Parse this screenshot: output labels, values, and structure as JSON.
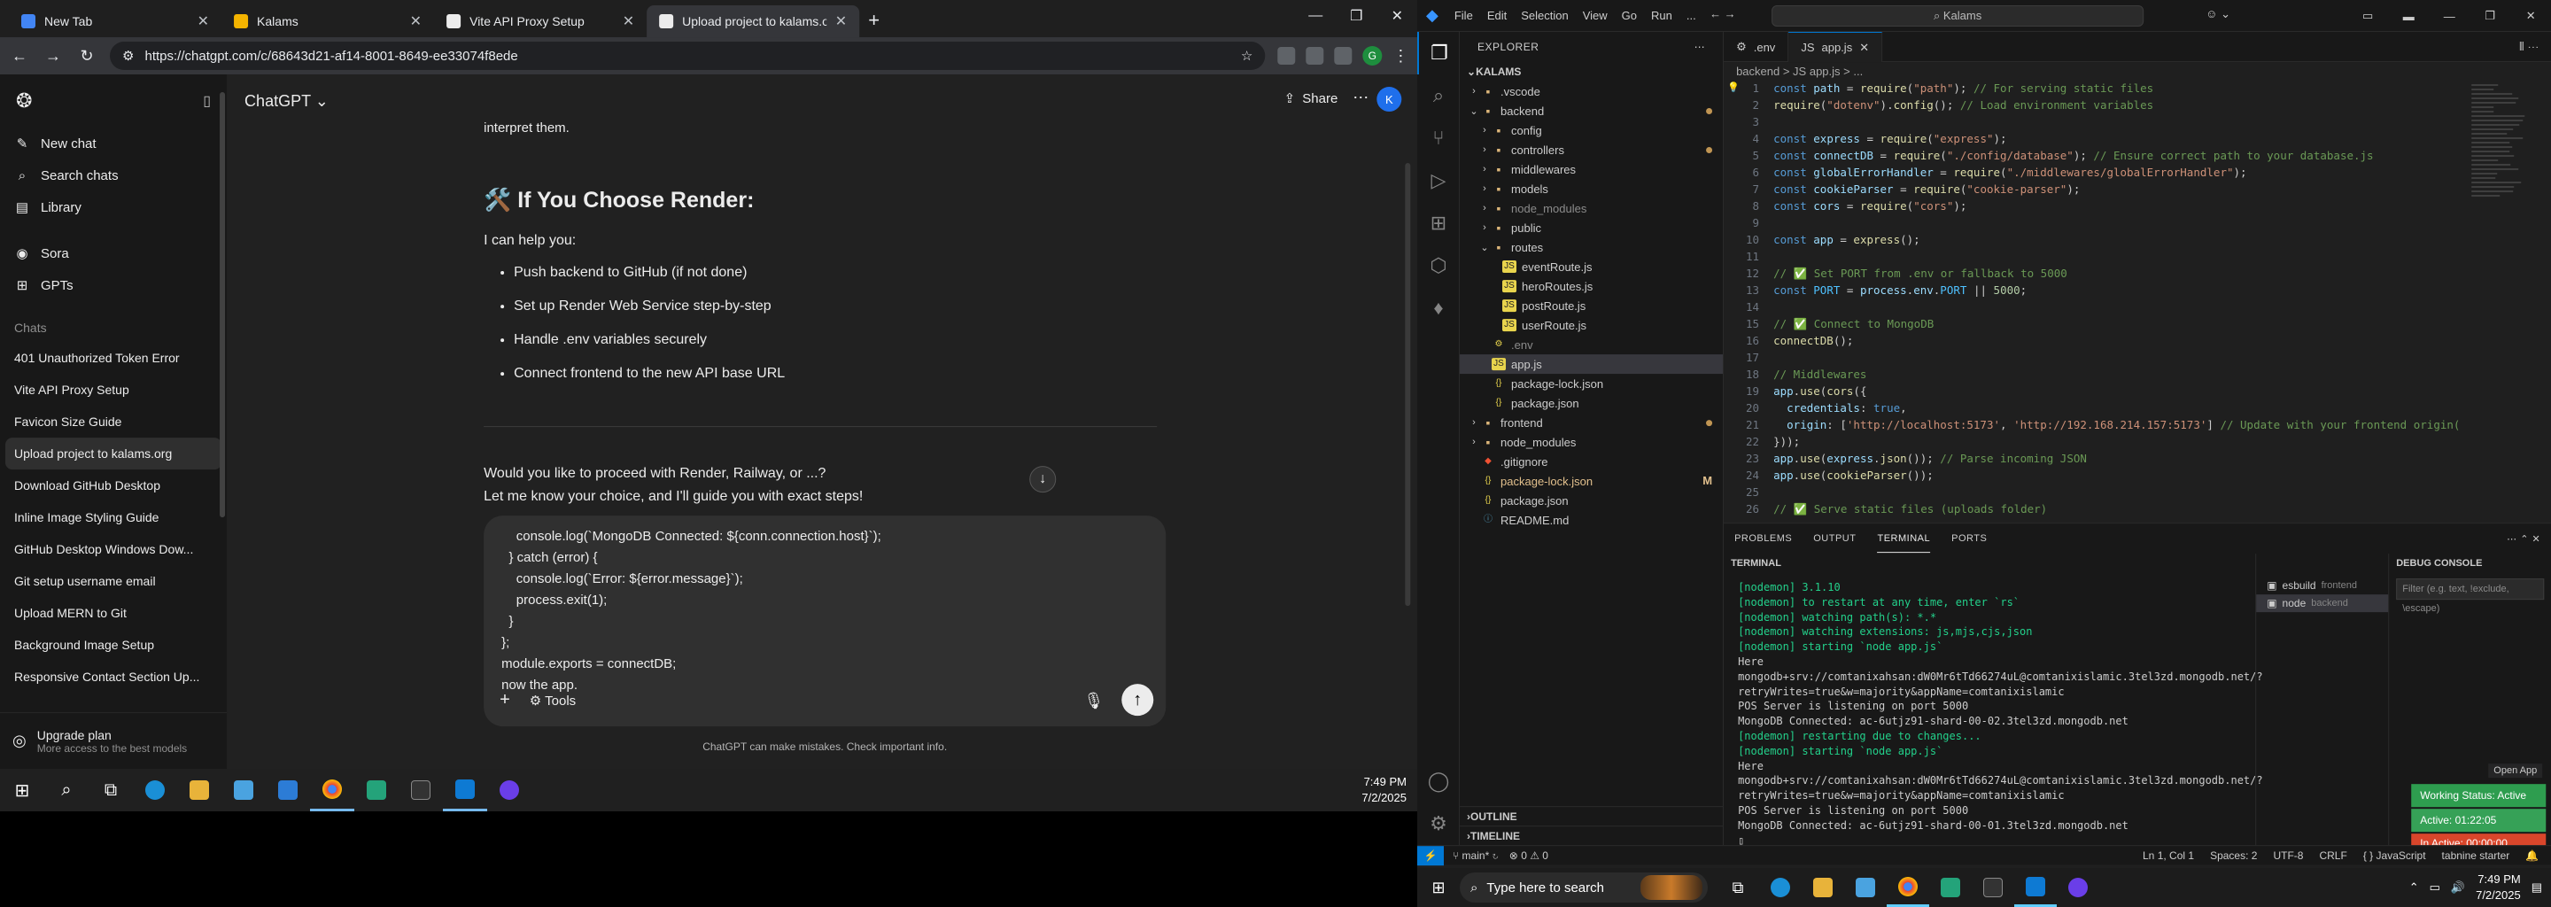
{
  "browser": {
    "tabs": [
      {
        "title": "New Tab",
        "color": "#4285f4",
        "active": false
      },
      {
        "title": "Kalams",
        "color": "#f4b400",
        "active": false
      },
      {
        "title": "Vite API Proxy Setup",
        "color": "#ececec",
        "active": false
      },
      {
        "title": "Upload project to kalams.org",
        "color": "#ececec",
        "active": true
      }
    ],
    "url": "https://chatgpt.com/c/68643d21-af14-8001-8649-ee33074f8ede"
  },
  "chatgpt": {
    "sidebar": {
      "items": [
        {
          "icon": "new-chat-icon",
          "label": "New chat"
        },
        {
          "icon": "search-icon",
          "label": "Search chats"
        },
        {
          "icon": "library-icon",
          "label": "Library"
        }
      ],
      "tools": [
        {
          "icon": "sora-icon",
          "label": "Sora"
        },
        {
          "icon": "gpts-icon",
          "label": "GPTs"
        }
      ],
      "chats_heading": "Chats",
      "chats": [
        "401 Unauthorized Token Error",
        "Vite API Proxy Setup",
        "Favicon Size Guide",
        "Upload project to kalams.org",
        "Download GitHub Desktop",
        "Inline Image Styling Guide",
        "GitHub Desktop Windows Dow...",
        "Git setup username email",
        "Upload MERN to Git",
        "Background Image Setup",
        "Responsive Contact Section Up..."
      ],
      "selected_chat_index": 3,
      "upgrade_title": "Upgrade plan",
      "upgrade_subtitle": "More access to the best models"
    },
    "model": "ChatGPT",
    "share_label": "Share",
    "avatar_initial": "K",
    "cut_line": "interpret them.",
    "heading": "🛠️ If You Choose Render:",
    "intro": "I can help you:",
    "bullets": [
      "Push backend to GitHub (if not done)",
      "Set up Render Web Service step-by-step",
      "Handle .env variables securely",
      "Connect frontend to the new API base URL"
    ],
    "question": "Would you like to proceed with Render, Railway, or ...?",
    "followup": "Let me know your choice, and I'll guide you with exact steps!",
    "composer_text": "    console.log(`MongoDB Connected: ${conn.connection.host}`);\n  } catch (error) {\n    console.log(`Error: ${error.message}`);\n    process.exit(1);\n  }\n};\nmodule.exports = connectDB;\nnow the app.",
    "tools_label": "Tools",
    "disclaimer": "ChatGPT can make mistakes. Check important info."
  },
  "taskbar_left": {
    "time": "7:49 PM",
    "date": "7/2/2025"
  },
  "vscode": {
    "menu": [
      "File",
      "Edit",
      "Selection",
      "View",
      "Go",
      "Run",
      "..."
    ],
    "search": "Kalams",
    "explorer_title": "EXPLORER",
    "project": "KALAMS",
    "tree": [
      {
        "name": ".vscode",
        "depth": 1,
        "type": "folder",
        "open": false
      },
      {
        "name": "backend",
        "depth": 1,
        "type": "folder",
        "open": true,
        "dot": true
      },
      {
        "name": "config",
        "depth": 2,
        "type": "folder",
        "open": false
      },
      {
        "name": "controllers",
        "depth": 2,
        "type": "folder",
        "open": false,
        "dot": true
      },
      {
        "name": "middlewares",
        "depth": 2,
        "type": "folder",
        "open": false
      },
      {
        "name": "models",
        "depth": 2,
        "type": "folder",
        "open": false
      },
      {
        "name": "node_modules",
        "depth": 2,
        "type": "folder",
        "open": false,
        "dim": true
      },
      {
        "name": "public",
        "depth": 2,
        "type": "folder",
        "open": false
      },
      {
        "name": "routes",
        "depth": 2,
        "type": "folder",
        "open": true
      },
      {
        "name": "eventRoute.js",
        "depth": 3,
        "type": "js"
      },
      {
        "name": "heroRoutes.js",
        "depth": 3,
        "type": "js"
      },
      {
        "name": "postRoute.js",
        "depth": 3,
        "type": "js"
      },
      {
        "name": "userRoute.js",
        "depth": 3,
        "type": "js"
      },
      {
        "name": ".env",
        "depth": 2,
        "type": "env",
        "dim": true
      },
      {
        "name": "app.js",
        "depth": 2,
        "type": "js",
        "selected": true
      },
      {
        "name": "package-lock.json",
        "depth": 2,
        "type": "json"
      },
      {
        "name": "package.json",
        "depth": 2,
        "type": "json"
      },
      {
        "name": "frontend",
        "depth": 1,
        "type": "folder",
        "open": false,
        "dot": true
      },
      {
        "name": "node_modules",
        "depth": 1,
        "type": "folder",
        "open": false
      },
      {
        "name": ".gitignore",
        "depth": 1,
        "type": "git"
      },
      {
        "name": "package-lock.json",
        "depth": 1,
        "type": "json",
        "mod": "M",
        "warn": true
      },
      {
        "name": "package.json",
        "depth": 1,
        "type": "json"
      },
      {
        "name": "README.md",
        "depth": 1,
        "type": "md"
      }
    ],
    "outline_label": "OUTLINE",
    "timeline_label": "TIMELINE",
    "editor_tabs": [
      ".env",
      "app.js"
    ],
    "breadcrumb": "backend > JS app.js > ...",
    "code": [
      "<span class=\"k\">const</span> <span class=\"v\">path</span> = <span class=\"f\">require</span>(<span class=\"s\">\"path\"</span>); <span class=\"c\">// For serving static files</span>",
      "<span class=\"f\">require</span>(<span class=\"s\">\"dotenv\"</span>).<span class=\"f\">config</span>(); <span class=\"c\">// Load environment variables</span>",
      "",
      "<span class=\"k\">const</span> <span class=\"v\">express</span> = <span class=\"f\">require</span>(<span class=\"s\">\"express\"</span>);",
      "<span class=\"k\">const</span> <span class=\"v\">connectDB</span> = <span class=\"f\">require</span>(<span class=\"s\">\"./config/database\"</span>); <span class=\"c\">// Ensure correct path to your database.js</span>",
      "<span class=\"k\">const</span> <span class=\"v\">globalErrorHandler</span> = <span class=\"f\">require</span>(<span class=\"s\">\"./middlewares/globalErrorHandler\"</span>);",
      "<span class=\"k\">const</span> <span class=\"v\">cookieParser</span> = <span class=\"f\">require</span>(<span class=\"s\">\"cookie-parser\"</span>);",
      "<span class=\"k\">const</span> <span class=\"v\">cors</span> = <span class=\"f\">require</span>(<span class=\"s\">\"cors\"</span>);",
      "",
      "<span class=\"k\">const</span> <span class=\"v\">app</span> = <span class=\"f\">express</span>();",
      "",
      "<span class=\"c\">// ✅ Set PORT from .env or fallback to 5000</span>",
      "<span class=\"k\">const</span> <span class=\"cls\">PORT</span> = <span class=\"v\">process</span>.<span class=\"v\">env</span>.<span class=\"cls\">PORT</span> || <span class=\"n\">5000</span>;",
      "",
      "<span class=\"c\">// ✅ Connect to MongoDB</span>",
      "<span class=\"f\">connectDB</span>();",
      "",
      "<span class=\"c\">// Middlewares</span>",
      "<span class=\"v\">app</span>.<span class=\"f\">use</span>(<span class=\"f\">cors</span>({",
      "  <span class=\"v\">credentials</span>: <span class=\"k\">true</span>,",
      "  <span class=\"v\">origin</span>: [<span class=\"s\">'http://localhost:5173'</span>, <span class=\"s\">'http://192.168.214.157:5173'</span>] <span class=\"c\">// Update with your frontend origin(</span>",
      "}));",
      "<span class=\"v\">app</span>.<span class=\"f\">use</span>(<span class=\"v\">express</span>.<span class=\"f\">json</span>()); <span class=\"c\">// Parse incoming JSON</span>",
      "<span class=\"v\">app</span>.<span class=\"f\">use</span>(<span class=\"f\">cookieParser</span>());",
      "",
      "<span class=\"c\">// ✅ Serve static files (uploads folder)</span>"
    ],
    "panel_tabs": [
      "PROBLEMS",
      "OUTPUT",
      "TERMINAL",
      "PORTS"
    ],
    "active_panel_tab": "TERMINAL",
    "terminal_title": "TERMINAL",
    "terminal_lines": [
      {
        "t": "[nodemon] 3.1.10",
        "g": true
      },
      {
        "t": "[nodemon] to restart at any time, enter `rs`",
        "g": true
      },
      {
        "t": "[nodemon] watching path(s): *.*",
        "g": true
      },
      {
        "t": "[nodemon] watching extensions: js,mjs,cjs,json",
        "g": true
      },
      {
        "t": "[nodemon] starting `node app.js`",
        "g": true
      },
      {
        "t": "Here",
        "g": false
      },
      {
        "t": "mongodb+srv://comtanixahsan:dW0Mr6tTd66274uL@comtanixislamic.3tel3zd.mongodb.net/?",
        "g": false
      },
      {
        "t": "retryWrites=true&w=majority&appName=comtanixislamic",
        "g": false
      },
      {
        "t": "POS Server is listening on port 5000",
        "g": false
      },
      {
        "t": "MongoDB Connected: ac-6utjz91-shard-00-02.3tel3zd.mongodb.net",
        "g": false
      },
      {
        "t": "[nodemon] restarting due to changes...",
        "g": true
      },
      {
        "t": "[nodemon] starting `node app.js`",
        "g": true
      },
      {
        "t": "Here",
        "g": false
      },
      {
        "t": "mongodb+srv://comtanixahsan:dW0Mr6tTd66274uL@comtanixislamic.3tel3zd.mongodb.net/?",
        "g": false
      },
      {
        "t": "retryWrites=true&w=majority&appName=comtanixislamic",
        "g": false
      },
      {
        "t": "POS Server is listening on port 5000",
        "g": false
      },
      {
        "t": "MongoDB Connected: ac-6utjz91-shard-00-01.3tel3zd.mongodb.net",
        "g": false
      },
      {
        "t": "▯",
        "g": false
      }
    ],
    "terminals": [
      {
        "name": "esbuild",
        "dir": "frontend"
      },
      {
        "name": "node",
        "dir": "backend"
      }
    ],
    "debug_title": "DEBUG CONSOLE",
    "debug_filter_placeholder": "Filter (e.g. text, !exclude, \\escape)",
    "open_app": "Open App",
    "working_status": "Working Status: Active",
    "active_time": "Active: 01:22:05",
    "inactive_time": "In Active: 00:00:00",
    "status": {
      "branch": "main*",
      "problems": "⊗ 0 ⚠ 0",
      "position": "Ln 1, Col 1",
      "spaces": "Spaces: 2",
      "encoding": "UTF-8",
      "eol": "CRLF",
      "lang": "JavaScript",
      "tabnine": "tabnine starter"
    }
  },
  "taskbar_right": {
    "search_placeholder": "Type here to search",
    "time": "7:49 PM",
    "date": "7/2/2025"
  }
}
